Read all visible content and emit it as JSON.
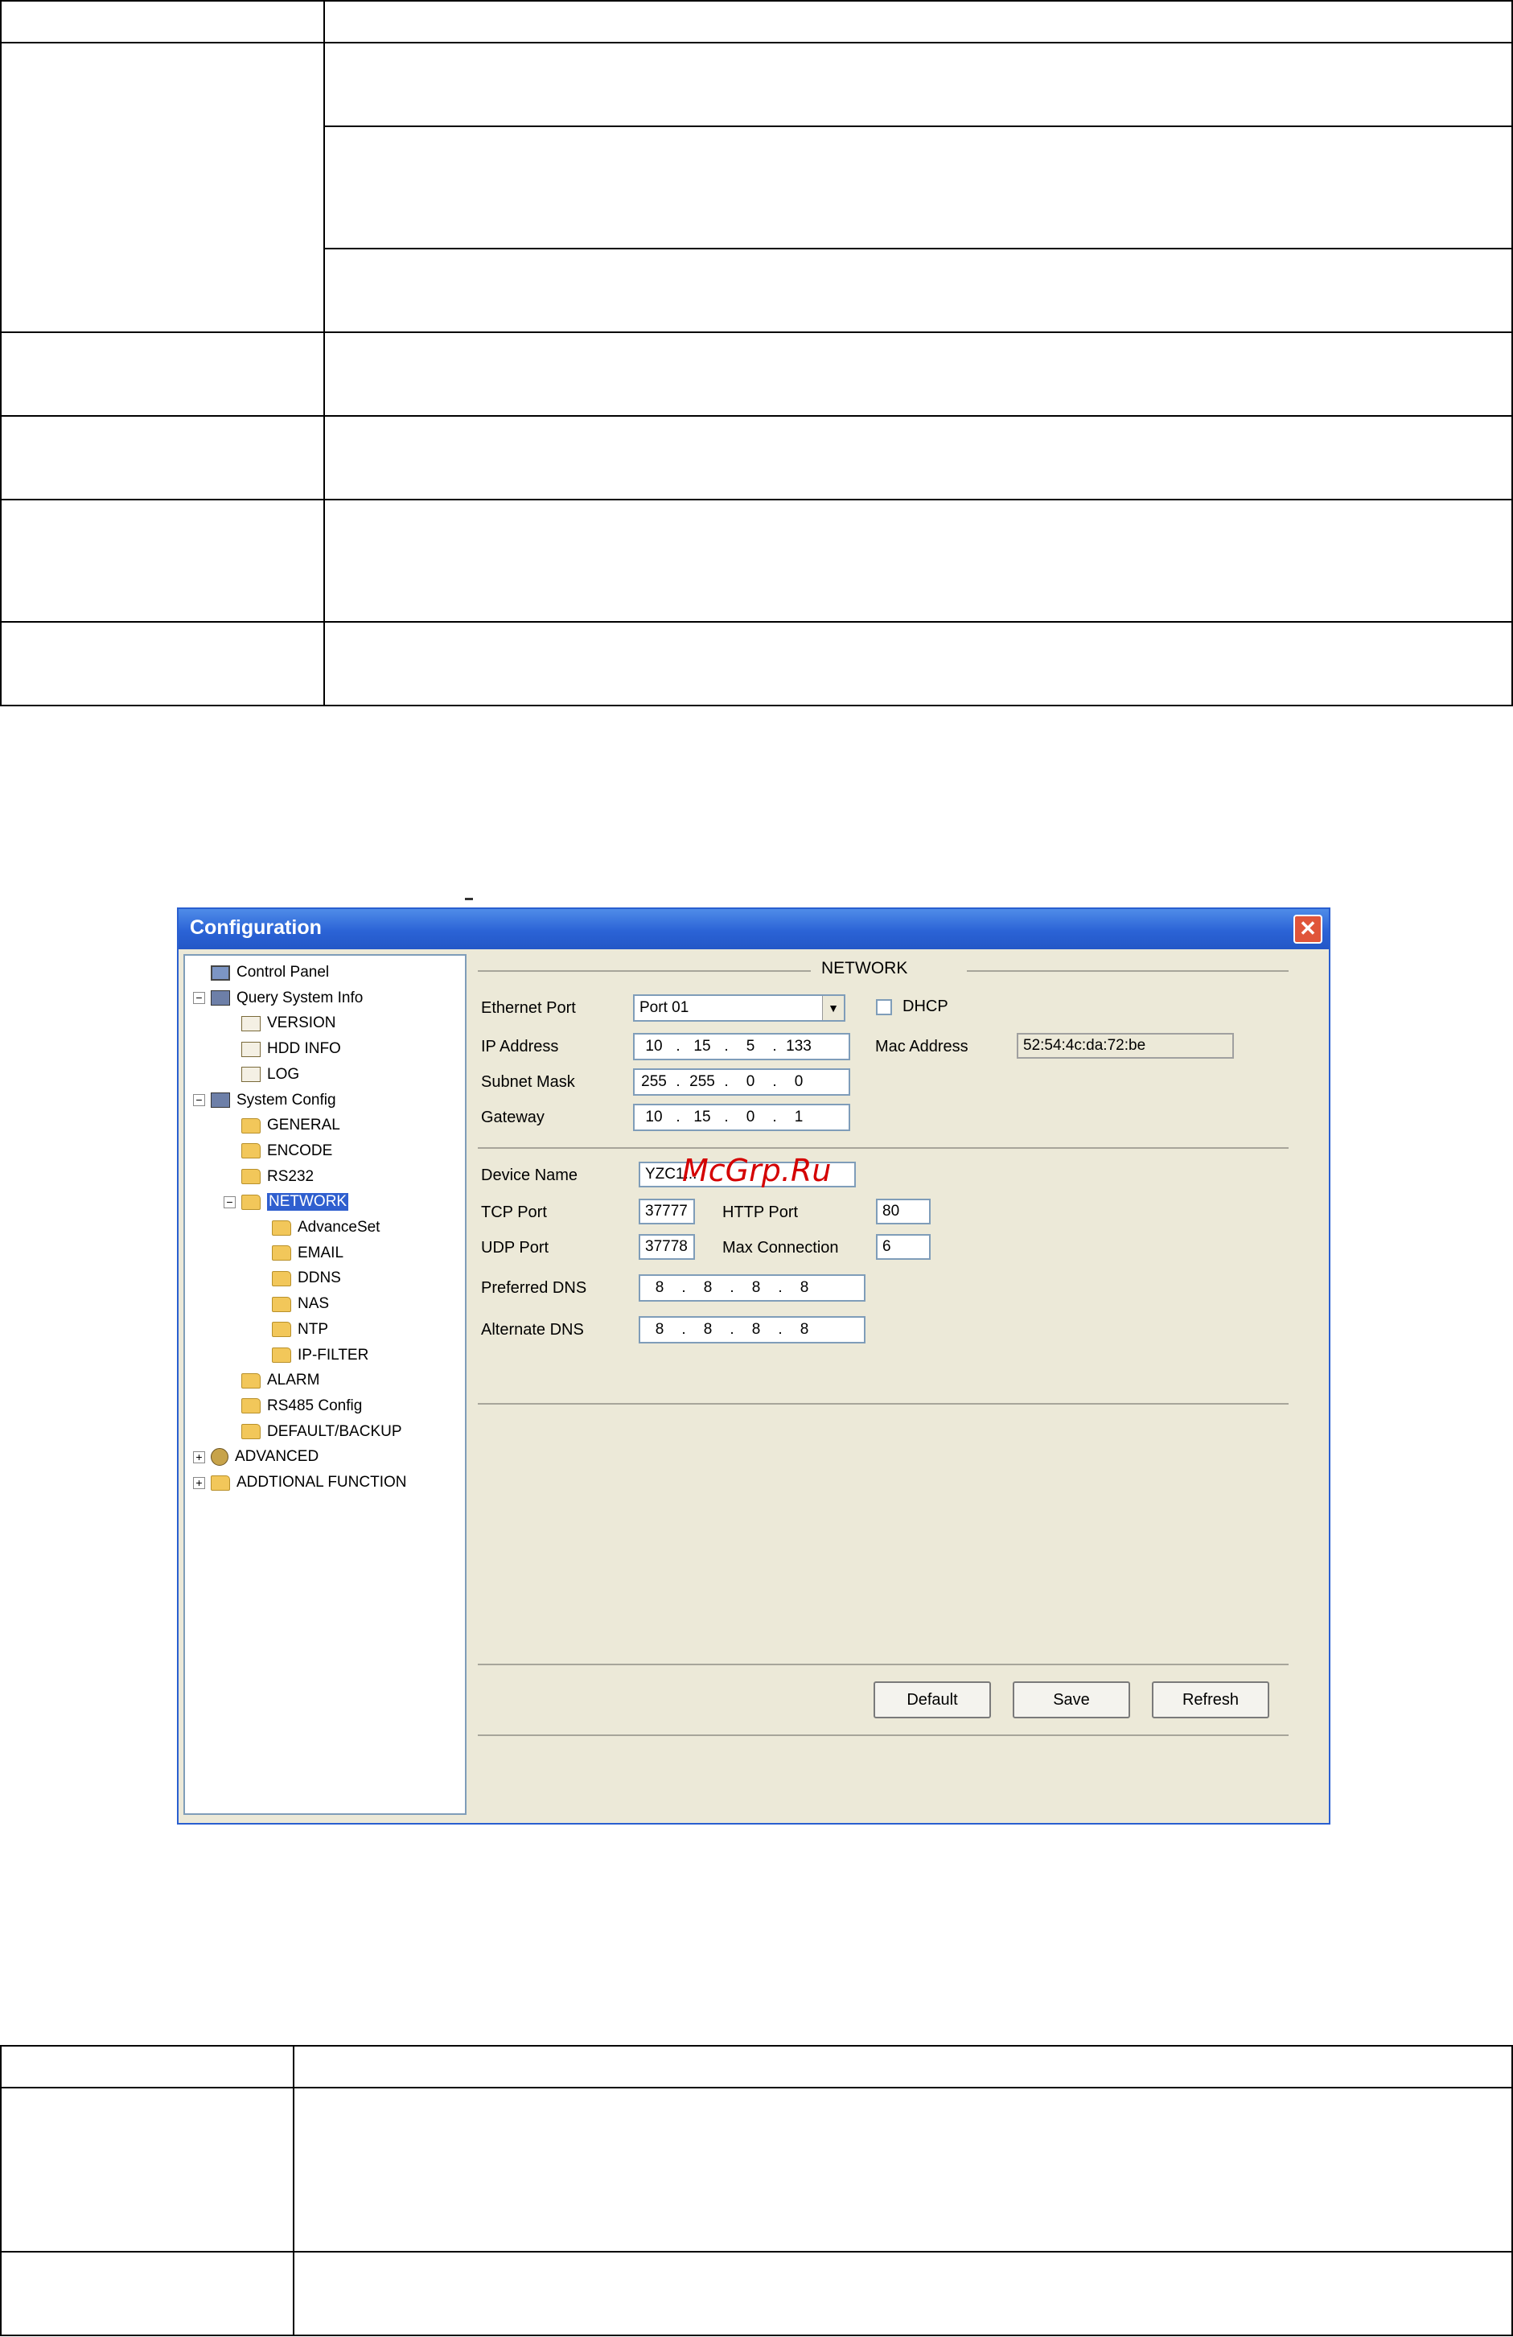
{
  "window": {
    "title": "Configuration",
    "close_glyph": "✕"
  },
  "tree": {
    "items": [
      {
        "label": "Control Panel",
        "icon": "monitor-icon",
        "expander": ""
      },
      {
        "label": "Query System Info",
        "icon": "tools-icon",
        "expander": "−"
      },
      {
        "label": "VERSION",
        "icon": "doc-icon",
        "expander": ""
      },
      {
        "label": "HDD INFO",
        "icon": "doc-icon",
        "expander": ""
      },
      {
        "label": "LOG",
        "icon": "doc-icon",
        "expander": ""
      },
      {
        "label": "System Config",
        "icon": "tools-icon",
        "expander": "−"
      },
      {
        "label": "GENERAL",
        "icon": "folder-icon",
        "expander": ""
      },
      {
        "label": "ENCODE",
        "icon": "folder-icon",
        "expander": ""
      },
      {
        "label": "RS232",
        "icon": "folder-icon",
        "expander": ""
      },
      {
        "label": "NETWORK",
        "icon": "folder-icon",
        "expander": "−",
        "selected": true
      },
      {
        "label": "AdvanceSet",
        "icon": "folder-icon",
        "expander": ""
      },
      {
        "label": "EMAIL",
        "icon": "folder-icon",
        "expander": ""
      },
      {
        "label": "DDNS",
        "icon": "folder-icon",
        "expander": ""
      },
      {
        "label": "NAS",
        "icon": "folder-icon",
        "expander": ""
      },
      {
        "label": "NTP",
        "icon": "folder-icon",
        "expander": ""
      },
      {
        "label": "IP-FILTER",
        "icon": "folder-icon",
        "expander": ""
      },
      {
        "label": "ALARM",
        "icon": "folder-icon",
        "expander": ""
      },
      {
        "label": "RS485 Config",
        "icon": "folder-icon",
        "expander": ""
      },
      {
        "label": "DEFAULT/BACKUP",
        "icon": "folder-icon",
        "expander": ""
      },
      {
        "label": "ADVANCED",
        "icon": "gear-icon",
        "expander": "+"
      },
      {
        "label": "ADDTIONAL FUNCTION",
        "icon": "folder-icon",
        "expander": "+"
      }
    ]
  },
  "network": {
    "section_title": "NETWORK",
    "ethernet_port_label": "Ethernet Port",
    "ethernet_port_value": "Port 01",
    "dhcp_label": "DHCP",
    "ip_label": "IP Address",
    "ip": [
      "10",
      "15",
      "5",
      "133"
    ],
    "mac_label": "Mac Address",
    "mac_value": "52:54:4c:da:72:be",
    "subnet_label": "Subnet Mask",
    "subnet": [
      "255",
      "255",
      "0",
      "0"
    ],
    "gateway_label": "Gateway",
    "gateway": [
      "10",
      "15",
      "0",
      "1"
    ],
    "device_name_label": "Device Name",
    "device_name_value": "YZC1...",
    "tcp_port_label": "TCP Port",
    "tcp_port_value": "37777",
    "http_port_label": "HTTP Port",
    "http_port_value": "80",
    "udp_port_label": "UDP Port",
    "udp_port_value": "37778",
    "max_connection_label": "Max Connection",
    "max_connection_value": "6",
    "preferred_dns_label": "Preferred DNS",
    "preferred_dns": [
      "8",
      "8",
      "8",
      "8"
    ],
    "alternate_dns_label": "Alternate DNS",
    "alternate_dns": [
      "8",
      "8",
      "8",
      "8"
    ]
  },
  "buttons": {
    "default_label": "Default",
    "save_label": "Save",
    "refresh_label": "Refresh"
  },
  "watermark": "McGrp.Ru"
}
